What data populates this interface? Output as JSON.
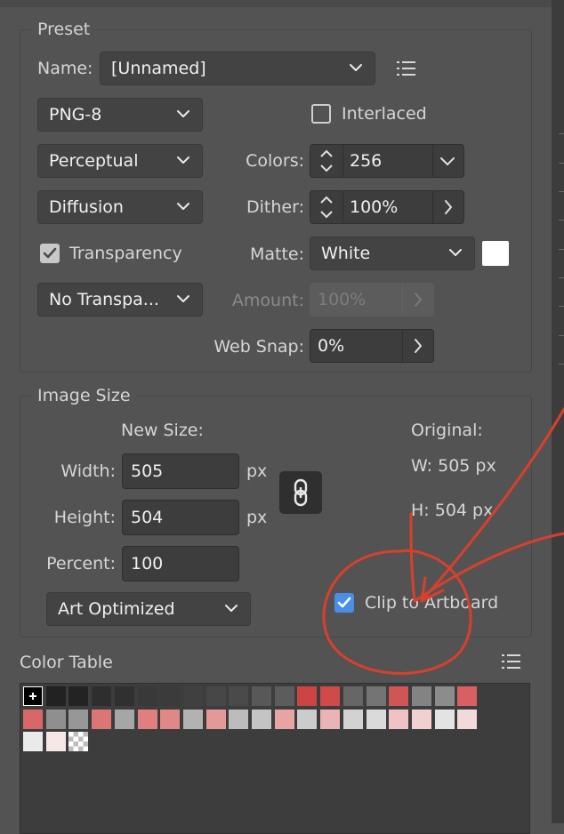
{
  "preset": {
    "legend": "Preset",
    "name_label": "Name:",
    "name_value": "[Unnamed]",
    "format": "PNG-8",
    "interlaced_label": "Interlaced",
    "interlaced_checked": false,
    "reduction": "Perceptual",
    "colors_label": "Colors:",
    "colors_value": "256",
    "dither_algo": "Diffusion",
    "dither_label": "Dither:",
    "dither_value": "100%",
    "transparency_label": "Transparency",
    "transparency_checked": true,
    "matte_label": "Matte:",
    "matte_value": "White",
    "matte_color": "#ffffff",
    "transparency_dither": "No Transpa...",
    "amount_label": "Amount:",
    "amount_value": "100%",
    "websnap_label": "Web Snap:",
    "websnap_value": "0%"
  },
  "image_size": {
    "legend": "Image Size",
    "new_size_label": "New Size:",
    "width_label": "Width:",
    "width_value": "505",
    "height_label": "Height:",
    "height_value": "504",
    "percent_label": "Percent:",
    "percent_value": "100",
    "unit": "px",
    "original_label": "Original:",
    "orig_w": "W:  505 px",
    "orig_h": "H:  504 px",
    "quality": "Art Optimized",
    "clip_label": "Clip to Artboard",
    "clip_checked": true
  },
  "color_table": {
    "legend": "Color Table",
    "cells": [
      "#000000",
      "#222222",
      "#232323",
      "#2e2e2e",
      "#303030",
      "#393939",
      "#3b3b3b",
      "#404040",
      "#474747",
      "#4a4a4a",
      "#585858",
      "#5c5c5c",
      "#cc4444",
      "#d04a4a",
      "#666666",
      "#747474",
      "#d05555",
      "#838383",
      "#8c8c8c",
      "#d86060",
      "#d86868",
      "#8f8f8f",
      "#979797",
      "#dc7575",
      "#a6a6a6",
      "#e07f7f",
      "#e08787",
      "#b2b2b2",
      "#e49898",
      "#bcbcbc",
      "#c4c4c4",
      "#e8a3a3",
      "#cccccc",
      "#ebb4b4",
      "#d2d2d2",
      "#dadada",
      "#efc3c3",
      "#f2d0d0",
      "#e3e3e3",
      "#f3dada",
      "#eaeaea",
      "#f7e8e8",
      "transparent"
    ],
    "accent": "#4b8ee8"
  }
}
